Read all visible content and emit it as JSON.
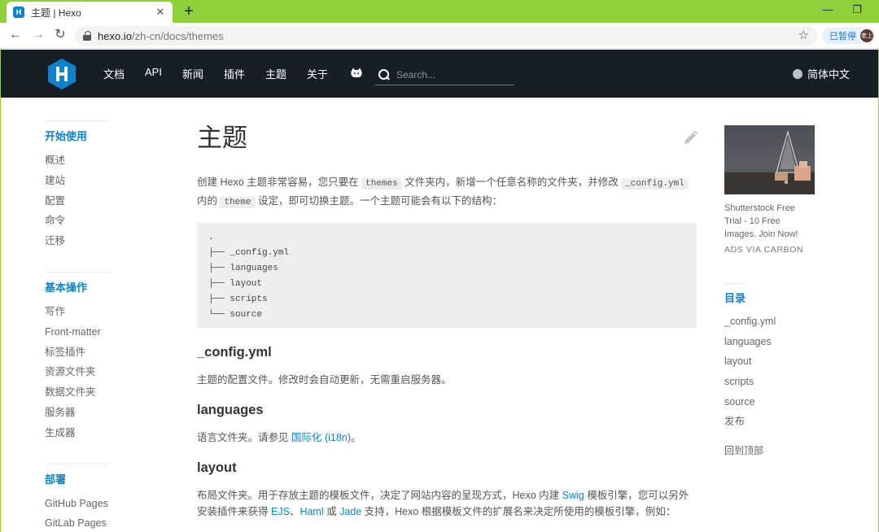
{
  "browser": {
    "tab_title": "主题 | Hexo",
    "tab_favicon": "H",
    "tab_close": "✕",
    "new_tab": "+",
    "minimize": "—",
    "restore": "❐",
    "back": "←",
    "forward": "→",
    "reload": "↻",
    "url_host": "hexo.io",
    "url_path": "/zh-cn/docs/themes",
    "bookmark_star": "☆",
    "profile_paused": "已暂停",
    "avatar_text": "老上"
  },
  "header": {
    "nav": [
      "文档",
      "API",
      "新闻",
      "插件",
      "主题",
      "关于"
    ],
    "search_placeholder": "Search...",
    "language": "简体中文"
  },
  "sidebar": {
    "groups": [
      {
        "title": "开始使用",
        "items": [
          "概述",
          "建站",
          "配置",
          "命令",
          "迁移"
        ]
      },
      {
        "title": "基本操作",
        "items": [
          "写作",
          "Front-matter",
          "标签插件",
          "资源文件夹",
          "数据文件夹",
          "服务器",
          "生成器"
        ]
      },
      {
        "title": "部署",
        "items": [
          "GitHub Pages",
          "GitLab Pages"
        ]
      }
    ]
  },
  "main": {
    "title": "主题",
    "intro": {
      "t1": "创建 Hexo 主题非常容易，您只要在 ",
      "c1": "themes",
      "t2": " 文件夹内，新增一个任意名称的文件夹，并修改 ",
      "c2": "_config.yml",
      "t3": " 内的 ",
      "c3": "theme",
      "t4": " 设定，即可切换主题。一个主题可能会有以下的结构："
    },
    "code_lines": [
      ".",
      "├── _config.yml",
      "├── languages",
      "├── layout",
      "├── scripts",
      "└── source"
    ],
    "sections": {
      "config": {
        "heading": "_config.yml",
        "text": "主题的配置文件。修改时会自动更新，无需重启服务器。"
      },
      "languages": {
        "heading": "languages",
        "text": "语言文件夹。请参见 ",
        "link": "国际化 (i18n)",
        "after": "。"
      },
      "layout": {
        "heading": "layout",
        "t1": "布局文件夹。用于存放主题的模板文件，决定了网站内容的呈现方式，Hexo 内建 ",
        "l1": "Swig",
        "t2": " 模板引擎，您可以另外安装插件来获得 ",
        "l2": "EJS",
        "t3": "、",
        "l3": "Haml",
        "t4": " 或 ",
        "l4": "Jade",
        "t5": " 支持，Hexo 根据模板文件的扩展名来决定所使用的模板引擎，例如："
      }
    }
  },
  "ad": {
    "text": "Shutterstock Free Trial - 10 Free Images. Join Now!",
    "via": "ADS VIA CARBON"
  },
  "toc": {
    "title": "目录",
    "items": [
      "_config.yml",
      "languages",
      "layout",
      "scripts",
      "source",
      "发布"
    ],
    "back_to_top": "回到顶部"
  },
  "colors": {
    "accent": "#0e83cd",
    "header_bg": "#171e26",
    "browser_tabbar": "#8fd13b"
  }
}
